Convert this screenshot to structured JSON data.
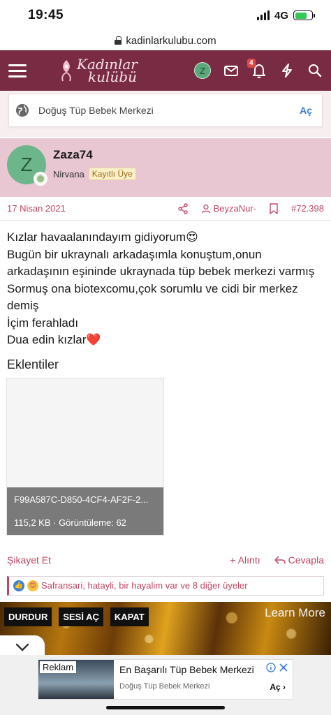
{
  "status_bar": {
    "time": "19:45",
    "network": "4G"
  },
  "url_bar": {
    "url": "kadinlarkulubu.com"
  },
  "header": {
    "logo_line1": "Kadınlar",
    "logo_line2": "kulübü",
    "avatar_letter": "Z",
    "notification_count": "4",
    "brand_color": "#7a2b44"
  },
  "search": {
    "text": "Doğuş Tüp Bebek Merkezi",
    "action": "Aç"
  },
  "profile": {
    "avatar_letter": "Z",
    "username": "Zaza74",
    "rank": "Nirvana",
    "badge": "Kayıtlı Üye"
  },
  "post": {
    "date": "17 Nisan 2021",
    "quoted_user": "BeyzaNur-",
    "post_number": "#72.398",
    "lines": [
      "Kızlar havaalanındayım gidiyorum😍",
      "Bugün bir ukraynalı arkadaşımla konuştum,onun",
      "arkadaşının eşininde ukraynada tüp bebek merkezi varmış",
      "Sormuş ona biotexcomu,çok sorumlu ve cidi bir merkez",
      "demiş",
      "İçim ferahladı",
      "Dua edin kızlar❤️"
    ]
  },
  "attachments": {
    "title": "Eklentiler",
    "file_name": "F99A587C-D850-4CF4-AF2F-2...",
    "file_info": "115,2 KB · Görüntüleme: 62"
  },
  "actions": {
    "report": "Şikayet Et",
    "quote": "+ Alıntı",
    "reply": "Cevapla"
  },
  "reactions": {
    "text": "Safransari, hatayli, bir hayalim var ve 8 diğer üyeler"
  },
  "video_ad": {
    "stop": "DURDUR",
    "unmute": "SESİ AÇ",
    "close": "KAPAT",
    "learn_more": "Learn More"
  },
  "banner_ad": {
    "label": "Reklam",
    "headline": "En Başarılı Tüp Bebek Merkezi",
    "sub": "Doğuş Tüp Bebek Merkezi",
    "cta": "Aç"
  }
}
